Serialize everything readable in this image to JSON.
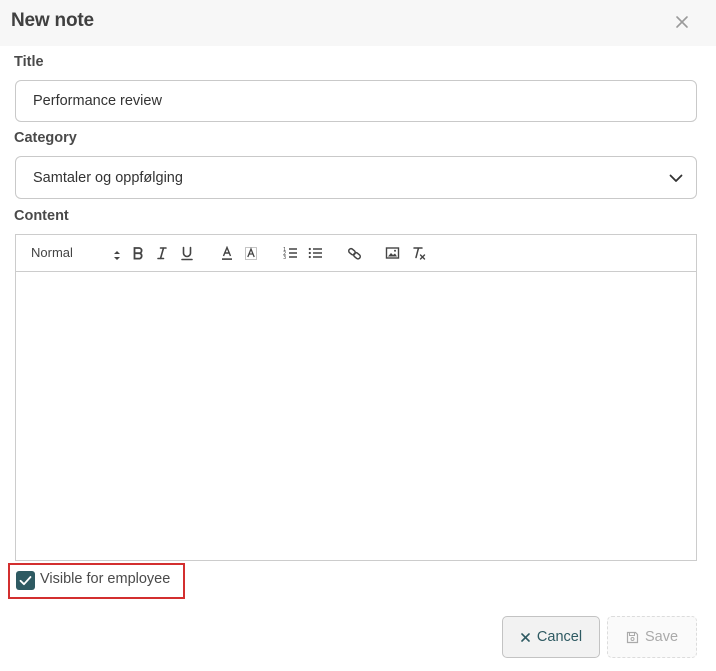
{
  "dialog": {
    "title": "New note",
    "close_icon": "close-icon"
  },
  "form": {
    "title_label": "Title",
    "title_value": "Performance review",
    "category_label": "Category",
    "category_value": "Samtaler og oppfølging",
    "content_label": "Content",
    "content_value": ""
  },
  "toolbar": {
    "format_value": "Normal",
    "icons": [
      "format-select-icon",
      "bold-icon",
      "italic-icon",
      "underline-icon",
      "text-color-icon",
      "background-color-icon",
      "ordered-list-icon",
      "bullet-list-icon",
      "link-icon",
      "image-icon",
      "clear-format-icon"
    ]
  },
  "visibility": {
    "checked": true,
    "label": "Visible for employee"
  },
  "actions": {
    "cancel_label": "Cancel",
    "save_label": "Save"
  },
  "colors": {
    "accent": "#2e5a62",
    "highlight_border": "#d32f2f",
    "header_bg": "#f7f7f7"
  }
}
